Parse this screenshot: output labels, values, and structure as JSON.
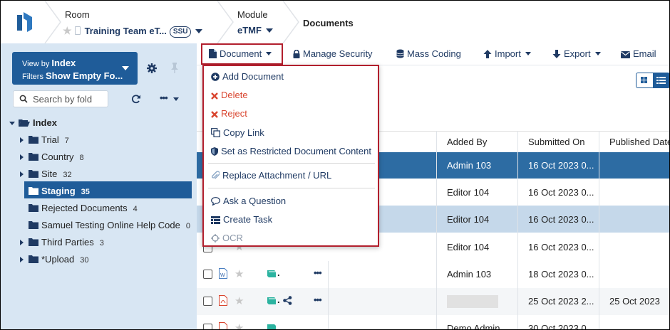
{
  "header": {
    "room_label": "Room",
    "room_value": "Training Team eT...",
    "room_badge": "SSU",
    "module_label": "Module",
    "module_value": "eTMF",
    "page_crumb": "Documents"
  },
  "sidebar": {
    "view_by_label": "View by",
    "view_by_value": "Index",
    "filters_label": "Filters",
    "filters_value": "Show Empty Fo...",
    "search_placeholder": "Search by fold",
    "tree": [
      {
        "label": "Index",
        "count": ""
      },
      {
        "label": "Trial",
        "count": "7"
      },
      {
        "label": "Country",
        "count": "8"
      },
      {
        "label": "Site",
        "count": "32"
      },
      {
        "label": "Staging",
        "count": "35"
      },
      {
        "label": "Rejected Documents",
        "count": "4"
      },
      {
        "label": "Samuel Testing Online Help Code",
        "count": "0"
      },
      {
        "label": "Third Parties",
        "count": "3"
      },
      {
        "label": "*Upload",
        "count": "30"
      }
    ]
  },
  "toolbar": {
    "document": "Document",
    "manage_security": "Manage Security",
    "mass_coding": "Mass Coding",
    "import": "Import",
    "export": "Export",
    "email": "Email"
  },
  "menu": {
    "add_document": "Add Document",
    "delete": "Delete",
    "reject": "Reject",
    "copy_link": "Copy Link",
    "restricted": "Set as Restricted Document Content",
    "replace": "Replace Attachment / URL",
    "ask_question": "Ask a Question",
    "create_task": "Create Task",
    "ocr": "OCR"
  },
  "table": {
    "columns": [
      "Added By",
      "Submitted On",
      "Published Date"
    ],
    "rows": [
      {
        "added_by": "Admin 103",
        "submitted_on": "16 Oct 2023 0...",
        "published": ""
      },
      {
        "added_by": "Editor 104",
        "submitted_on": "16 Oct 2023 0...",
        "published": ""
      },
      {
        "added_by": "Editor 104",
        "submitted_on": "16 Oct 2023 0...",
        "published": ""
      },
      {
        "added_by": "Editor 104",
        "submitted_on": "16 Oct 2023 0...",
        "published": ""
      },
      {
        "added_by": "Admin 103",
        "submitted_on": "18 Oct 2023 0...",
        "published": ""
      },
      {
        "added_by": "",
        "submitted_on": "25 Oct 2023 2...",
        "published": "25 Oct 2023"
      },
      {
        "added_by": "Demo Admin",
        "submitted_on": "30 Oct 2023 0...",
        "published": ""
      }
    ]
  },
  "colors": {
    "brand_blue": "#1f5c99",
    "navy_text": "#1f3a63",
    "highlight_red": "#b21f2d",
    "delete_red": "#d9452f",
    "sidebar_bg": "#d8e6f3",
    "selected_row": "#2d6ca3",
    "light_row": "#c5d8ea"
  }
}
